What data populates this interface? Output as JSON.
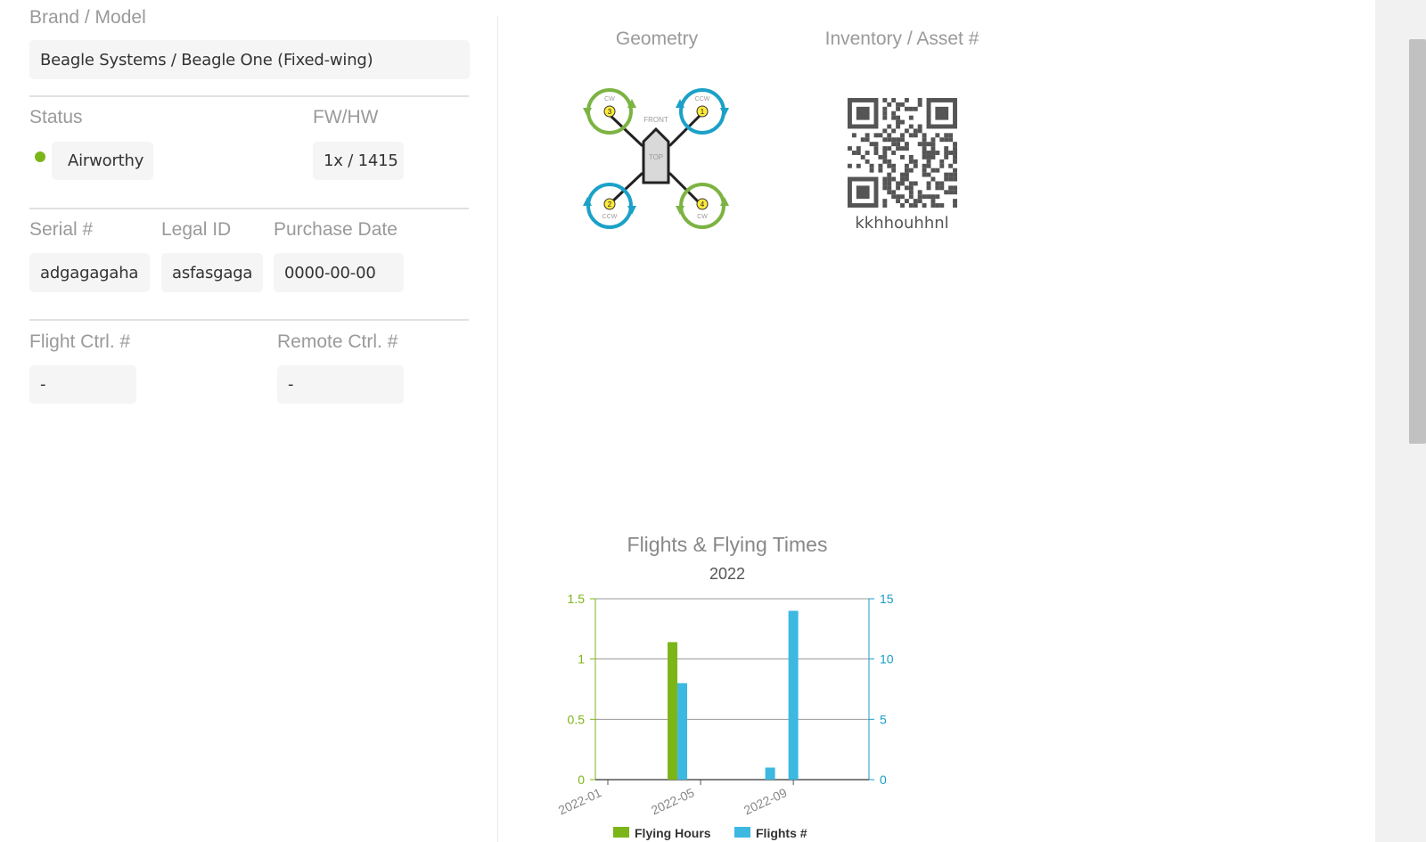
{
  "form": {
    "brand_model_label": "Brand / Model",
    "brand_model_value": "Beagle Systems / Beagle One (Fixed-wing)",
    "status_label": "Status",
    "status_value": "Airworthy",
    "status_color": "#7cb518",
    "fwhw_label": "FW/HW",
    "fwhw_value": "1x / 1415",
    "serial_label": "Serial #",
    "serial_value": "adgagagaha",
    "legal_label": "Legal ID",
    "legal_value": "asfasgaga",
    "purchase_label": "Purchase Date",
    "purchase_value": "0000-00-00",
    "flightctrl_label": "Flight Ctrl. #",
    "flightctrl_value": "-",
    "remotectrl_label": "Remote Ctrl. #",
    "remotectrl_value": "-"
  },
  "geometry": {
    "title": "Geometry",
    "front_label": "FRONT",
    "top_label": "TOP",
    "rotors": [
      {
        "num": "3",
        "dir": "CW",
        "color": "#7cb342"
      },
      {
        "num": "1",
        "dir": "CCW",
        "color": "#1ba1c8"
      },
      {
        "num": "2",
        "dir": "CCW",
        "color": "#1ba1c8"
      },
      {
        "num": "4",
        "dir": "CW",
        "color": "#7cb342"
      }
    ]
  },
  "inventory": {
    "title": "Inventory / Asset #",
    "code": "kkhhouhhnl"
  },
  "chart_data": {
    "type": "bar",
    "title": "Flights & Flying Times",
    "subtitle": "2022",
    "x_ticks": [
      "2022-01",
      "2022-05",
      "2022-09"
    ],
    "y_left": {
      "ticks": [
        "0",
        "0.5",
        "1",
        "1.5"
      ],
      "range": [
        0,
        1.5
      ],
      "color": "#7cb518"
    },
    "y_right": {
      "ticks": [
        "0",
        "5",
        "10",
        "15"
      ],
      "range": [
        0,
        15
      ],
      "color": "#1a9dc8"
    },
    "series": [
      {
        "name": "Flying Hours",
        "axis": "left",
        "color": "#7cb518",
        "points": [
          {
            "x": "2022-04",
            "y": 1.14
          }
        ]
      },
      {
        "name": "Flights #",
        "axis": "right",
        "color": "#3db8e0",
        "points": [
          {
            "x": "2022-04",
            "y": 8
          },
          {
            "x": "2022-08",
            "y": 1
          },
          {
            "x": "2022-09",
            "y": 14
          }
        ]
      }
    ],
    "legend": "bottom",
    "grid": true
  }
}
